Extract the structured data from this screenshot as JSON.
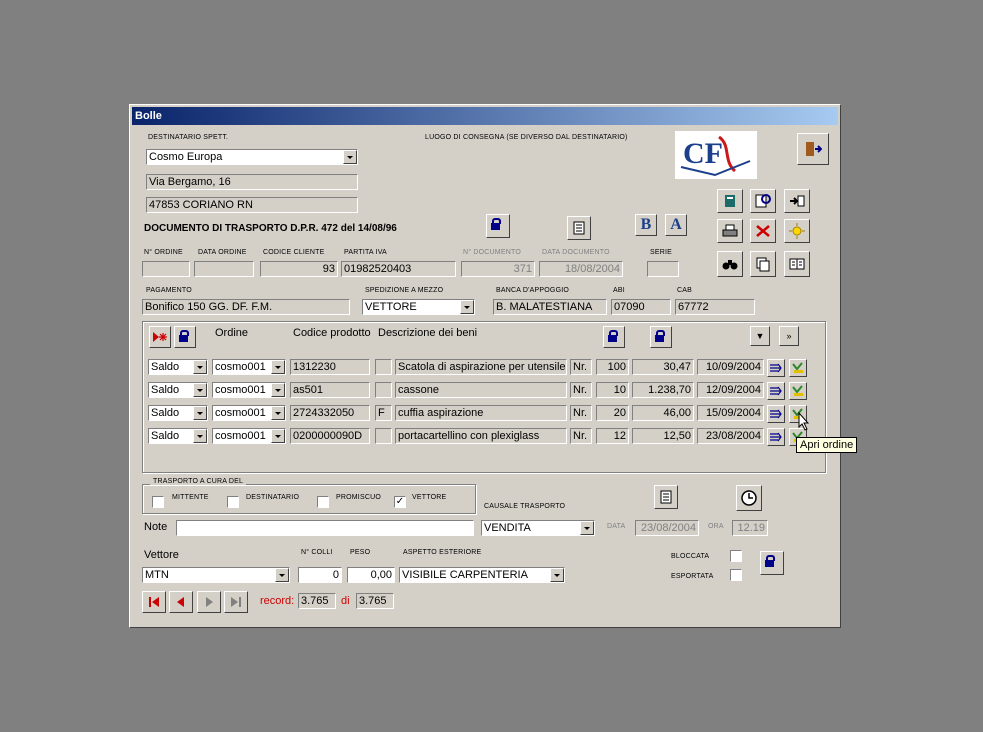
{
  "window": {
    "title": "Bolle"
  },
  "destinatario": {
    "label": "DESTINATARIO SPETT.",
    "name": "Cosmo Europa",
    "address": "Via Bergamo, 16",
    "city": "47853 CORIANO RN"
  },
  "luogo_consegna_label": "LUOGO DI CONSEGNA (SE DIVERSO DAL DESTINATARIO)",
  "logo_text": "CF",
  "document_title": "DOCUMENTO DI TRASPORTO D.P.R. 472 del 14/08/96",
  "header_fields": {
    "n_ordine_label": "N° ORDINE",
    "n_ordine": "",
    "data_ordine_label": "DATA ORDINE",
    "data_ordine": "",
    "codice_cliente_label": "CODICE CLIENTE",
    "codice_cliente": "93",
    "partita_iva_label": "PARTITA IVA",
    "partita_iva": "01982520403",
    "n_documento_label": "N° DOCUMENTO",
    "n_documento": "371",
    "data_documento_label": "DATA DOCUMENTO",
    "data_documento": "18/08/2004",
    "serie_label": "SERIE",
    "serie": ""
  },
  "pagamento": {
    "label": "PAGAMENTO",
    "value": "Bonifico 150 GG. DF. F.M."
  },
  "spedizione": {
    "label": "SPEDIZIONE A MEZZO",
    "value": "VETTORE"
  },
  "banca": {
    "label": "BANCA D'APPOGGIO",
    "value": "B. MALATESTIANA"
  },
  "abi": {
    "label": "ABI",
    "value": "07090"
  },
  "cab": {
    "label": "CAB",
    "value": "67772"
  },
  "grid": {
    "col_ordine": "Ordine",
    "col_codice": "Codice prodotto",
    "col_descrizione": "Descrizione dei beni",
    "rows": [
      {
        "tipo": "Saldo",
        "ordine": "cosmo001",
        "codice": "1312230",
        "flag": "",
        "descrizione": "Scatola di aspirazione per utensile c",
        "um": "Nr.",
        "qty": "100",
        "prezzo": "30,47",
        "data": "10/09/2004"
      },
      {
        "tipo": "Saldo",
        "ordine": "cosmo001",
        "codice": "as501",
        "flag": "",
        "descrizione": "cassone",
        "um": "Nr.",
        "qty": "10",
        "prezzo": "1.238,70",
        "data": "12/09/2004"
      },
      {
        "tipo": "Saldo",
        "ordine": "cosmo001",
        "codice": "2724332050",
        "flag": "F",
        "descrizione": "cuffia aspirazione",
        "um": "Nr.",
        "qty": "20",
        "prezzo": "46,00",
        "data": "15/09/2004"
      },
      {
        "tipo": "Saldo",
        "ordine": "cosmo001",
        "codice": "0200000090D",
        "flag": "",
        "descrizione": "portacartellino con plexiglass",
        "um": "Nr.",
        "qty": "12",
        "prezzo": "12,50",
        "data": "23/08/2004"
      }
    ]
  },
  "tooltip": "Apri ordine",
  "trasporto": {
    "label": "TRASPORTO A CURA DEL",
    "mittente": "MITTENTE",
    "destinatario": "DESTINATARIO",
    "promiscuo": "PROMISCUO",
    "vettore": "VETTORE"
  },
  "causale": {
    "label": "CAUSALE TRASPORTO",
    "value": "VENDITA"
  },
  "note": {
    "label": "Note",
    "value": ""
  },
  "data_trasporto": {
    "label": "DATA",
    "value": "23/08/2004"
  },
  "ora": {
    "label": "ORA",
    "value": "12.19"
  },
  "vettore": {
    "label": "Vettore",
    "value": "MTN"
  },
  "n_colli": {
    "label": "N° COLLI",
    "value": "0"
  },
  "peso": {
    "label": "PESO",
    "value": "0,00"
  },
  "aspetto": {
    "label": "ASPETTO ESTERIORE",
    "value": "VISIBILE CARPENTERIA"
  },
  "bloccata_label": "BLOCCATA",
  "esportata_label": "ESPORTATA",
  "record": {
    "label": "record:",
    "current": "3.765",
    "of": "di",
    "total": "3.765"
  },
  "colors": {
    "titlebar_start": "#0a246a",
    "titlebar_end": "#a6caf0",
    "window_bg": "#d4d0c8",
    "nav_red": "#cc0000",
    "accent_blue": "#000088"
  }
}
